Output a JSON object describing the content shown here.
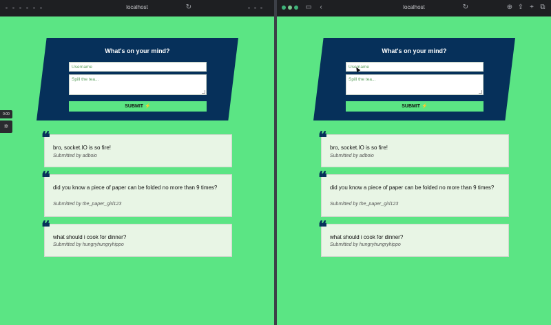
{
  "colors": {
    "background": "#5be584",
    "form_bg": "#06305a",
    "card_bg": "#e8f5e5",
    "accent_green": "#5be584"
  },
  "left_browser": {
    "host": "localhost",
    "reload_icon": "reload-icon"
  },
  "right_browser": {
    "host": "localhost",
    "icons": [
      "sidebar-icon",
      "back-icon",
      "reload-icon",
      "download-icon",
      "share-icon",
      "new-tab-icon",
      "tabs-icon"
    ]
  },
  "recorder": {
    "time": "0:00"
  },
  "form": {
    "title": "What's on your mind?",
    "username_placeholder": "Username",
    "message_placeholder": "Spill the tea...",
    "submit_label": "SUBMIT ⚡"
  },
  "posts": [
    {
      "text": "bro, socket.IO is so fire!",
      "author": "Submitted by adboio"
    },
    {
      "text": "did you know a piece of paper can be folded no more than 9 times?",
      "author": "Submitted by the_paper_girl123"
    },
    {
      "text": "what should i cook for dinner?",
      "author": "Submitted by hungryhungryhippo"
    }
  ]
}
